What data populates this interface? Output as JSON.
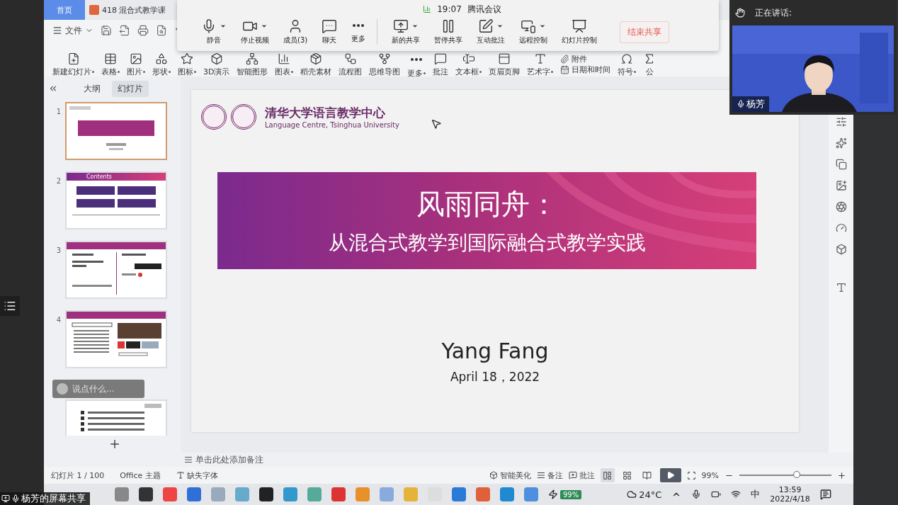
{
  "tabs": [
    {
      "label": "首页",
      "selected": true
    },
    {
      "label": "418 混合式教学课",
      "selected": false
    }
  ],
  "menu": {
    "label": "文件"
  },
  "ribbon": [
    {
      "label": "新建幻灯片",
      "dropdown": true
    },
    {
      "label": "表格",
      "dropdown": true
    },
    {
      "label": "图片",
      "dropdown": true
    },
    {
      "label": "形状",
      "dropdown": true
    },
    {
      "label": "图标",
      "dropdown": true
    },
    {
      "label": "3D演示",
      "dropdown": false
    },
    {
      "label": "智能图形",
      "dropdown": false
    },
    {
      "label": "图表",
      "dropdown": true
    },
    {
      "label": "稻壳素材",
      "dropdown": false
    },
    {
      "label": "流程图",
      "dropdown": false
    },
    {
      "label": "思维导图",
      "dropdown": false
    },
    {
      "label": "更多",
      "dropdown": true
    },
    {
      "label": "批注",
      "dropdown": false
    },
    {
      "label": "文本框",
      "dropdown": true
    },
    {
      "label": "页眉页脚",
      "dropdown": false
    },
    {
      "label": "艺术字",
      "dropdown": true
    }
  ],
  "ribbon_small": [
    {
      "label": "附件"
    },
    {
      "label": "日期和时间"
    }
  ],
  "ribbon_tail": [
    {
      "label": "符号",
      "dropdown": true
    },
    {
      "label": "公",
      "dropdown": false
    }
  ],
  "meeting": {
    "time": "19:07",
    "title": "腾讯会议",
    "buttons_left": [
      {
        "label": "静音",
        "dropdown": true
      },
      {
        "label": "停止视频",
        "dropdown": true
      },
      {
        "label": "成员(3)",
        "dropdown": false
      },
      {
        "label": "聊天",
        "dropdown": false
      },
      {
        "label": "更多",
        "dropdown": false
      }
    ],
    "buttons_right": [
      {
        "label": "新的共享",
        "dropdown": true
      },
      {
        "label": "暂停共享",
        "dropdown": false
      },
      {
        "label": "互动批注",
        "dropdown": true
      },
      {
        "label": "远程控制",
        "dropdown": true
      },
      {
        "label": "幻灯片控制",
        "dropdown": false
      }
    ],
    "end_button": "结束共享"
  },
  "speaker": {
    "header": "正在讲话:",
    "name": "杨芳"
  },
  "panel": {
    "tabs": [
      {
        "label": "大纲",
        "selected": false
      },
      {
        "label": "幻灯片",
        "selected": true
      }
    ],
    "slides": [
      {
        "number": "1",
        "selected": true,
        "kind": "title"
      },
      {
        "number": "2",
        "selected": false,
        "kind": "contents",
        "heading": "Contents"
      },
      {
        "number": "3",
        "selected": false,
        "kind": "columns"
      },
      {
        "number": "4",
        "selected": false,
        "kind": "list"
      },
      {
        "selected": false,
        "kind": "text"
      }
    ]
  },
  "chat_input": {
    "placeholder": "说点什么..."
  },
  "slide": {
    "org_name": "清华大学语言教学中心",
    "org_name_en": "Language Centre, Tsinghua University",
    "title": "风雨同舟：",
    "subtitle": "从混合式教学到国际融合式教学实践",
    "author": "Yang Fang",
    "date": "April 18，2022"
  },
  "notes": {
    "placeholder": "单击此处添加备注"
  },
  "status_bar": {
    "slide_count": "幻灯片 1 / 100",
    "theme": "Office 主题",
    "missing_font": "缺失字体",
    "beautify": "智能美化",
    "notes": "备注",
    "comments": "批注",
    "zoom": "99%",
    "zoom_slider": {
      "level": 0.62
    },
    "views": [
      {
        "kind": "normal",
        "selected": true
      },
      {
        "kind": "sorter",
        "selected": false
      },
      {
        "kind": "reading",
        "selected": false
      }
    ]
  },
  "taskbar": {
    "battery": "99%",
    "weather": "24°C",
    "ime": "中",
    "time": "13:59",
    "date": "2022/4/18"
  },
  "share_label": "杨芳的屏幕共享"
}
